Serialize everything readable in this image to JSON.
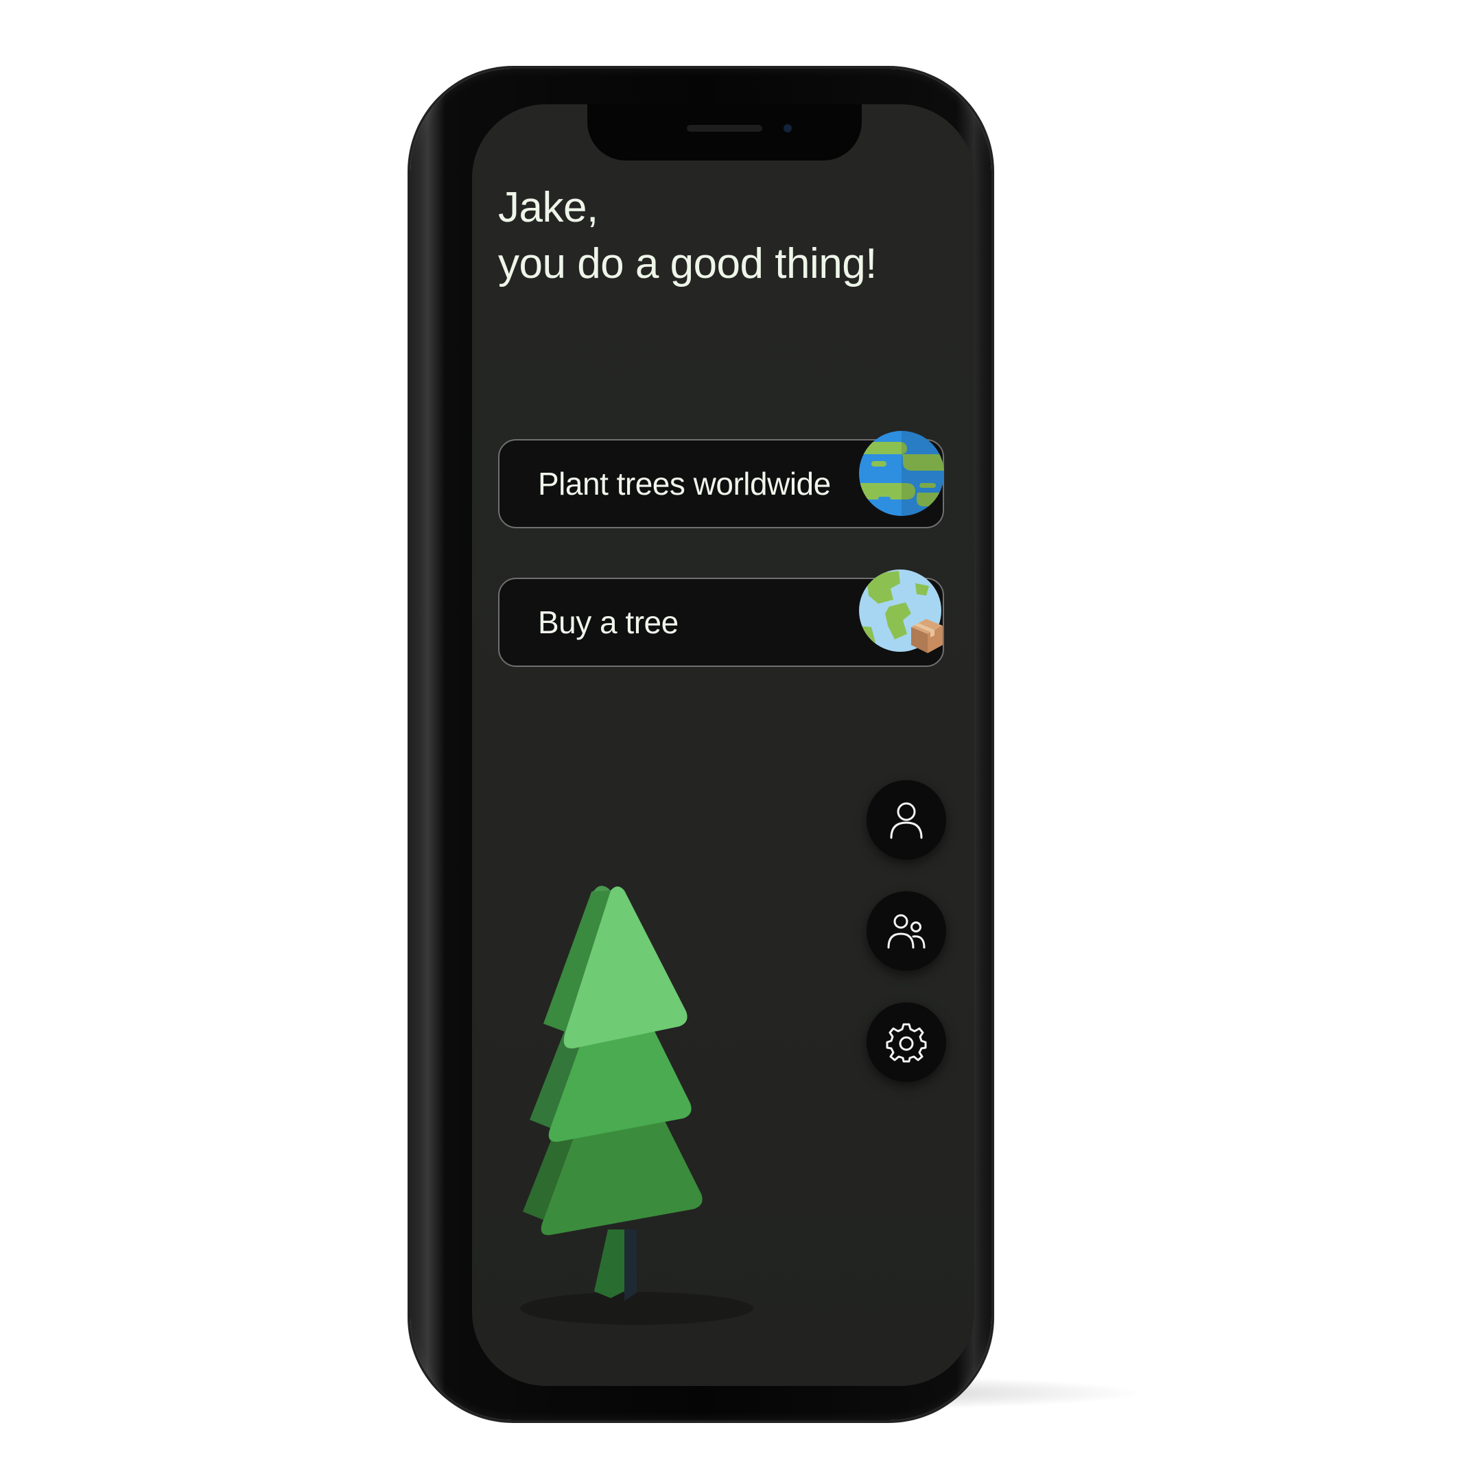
{
  "greeting": {
    "line1": "Jake,",
    "line2": "you do a good thing!"
  },
  "actions": [
    {
      "label": "Plant trees worldwide",
      "icon": "earth-globe-icon"
    },
    {
      "label": "Buy a tree",
      "icon": "globe-with-package-icon"
    }
  ],
  "nav": [
    {
      "icon": "user-icon"
    },
    {
      "icon": "users-icon"
    },
    {
      "icon": "gear-icon"
    }
  ],
  "theme": {
    "background": "#242523",
    "card": "#0f0f0f",
    "text": "#eef5e9",
    "accent_green": "#5cc46b",
    "globe_blue": "#2e8fe0"
  }
}
